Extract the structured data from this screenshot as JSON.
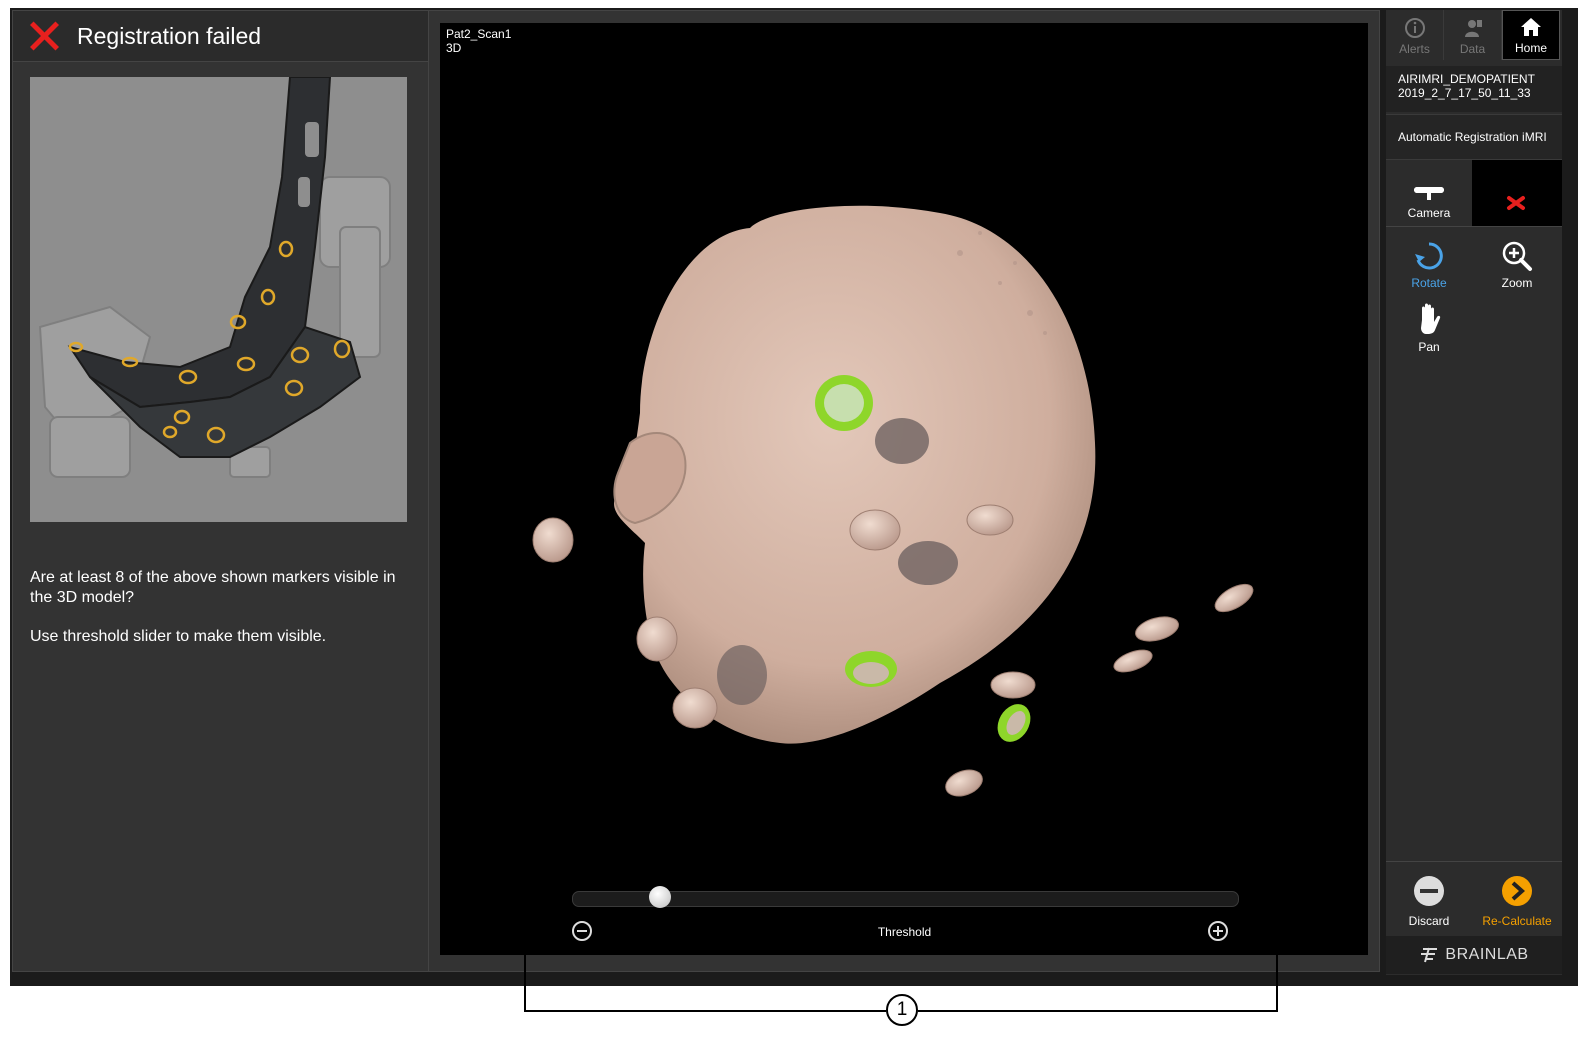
{
  "left_panel": {
    "title": "Registration failed",
    "instructions": [
      "Are at least 8 of the above shown markers visible in the 3D model?",
      "Use threshold slider to make them visible."
    ]
  },
  "viewer": {
    "scan_name": "Pat2_Scan1",
    "view_mode": "3D",
    "threshold": {
      "label": "Threshold",
      "value_fraction": 0.12
    }
  },
  "right_panel": {
    "nav": [
      {
        "label": "Alerts",
        "icon": "info-icon",
        "active": false
      },
      {
        "label": "Data",
        "icon": "data-icon",
        "active": false
      },
      {
        "label": "Home",
        "icon": "home-icon",
        "active": true
      }
    ],
    "patient_name": "AIRIMRI_DEMOPATIENT",
    "patient_date": "2019_2_7_17_50_11_33",
    "workflow": "Automatic Registration iMRI",
    "tools": {
      "camera": "Camera",
      "rotate": "Rotate",
      "zoom": "Zoom",
      "pan": "Pan"
    },
    "discard_label": "Discard",
    "recalculate_label": "Re-Calculate",
    "brand": "BRAINLAB"
  },
  "callout": {
    "number": "1"
  },
  "colors": {
    "error_red": "#e8201e",
    "accent_orange": "#f5a000",
    "rotate_blue": "#4aa3e8",
    "skin": "#d4b5a5",
    "marker_green": "#8ed62a"
  }
}
